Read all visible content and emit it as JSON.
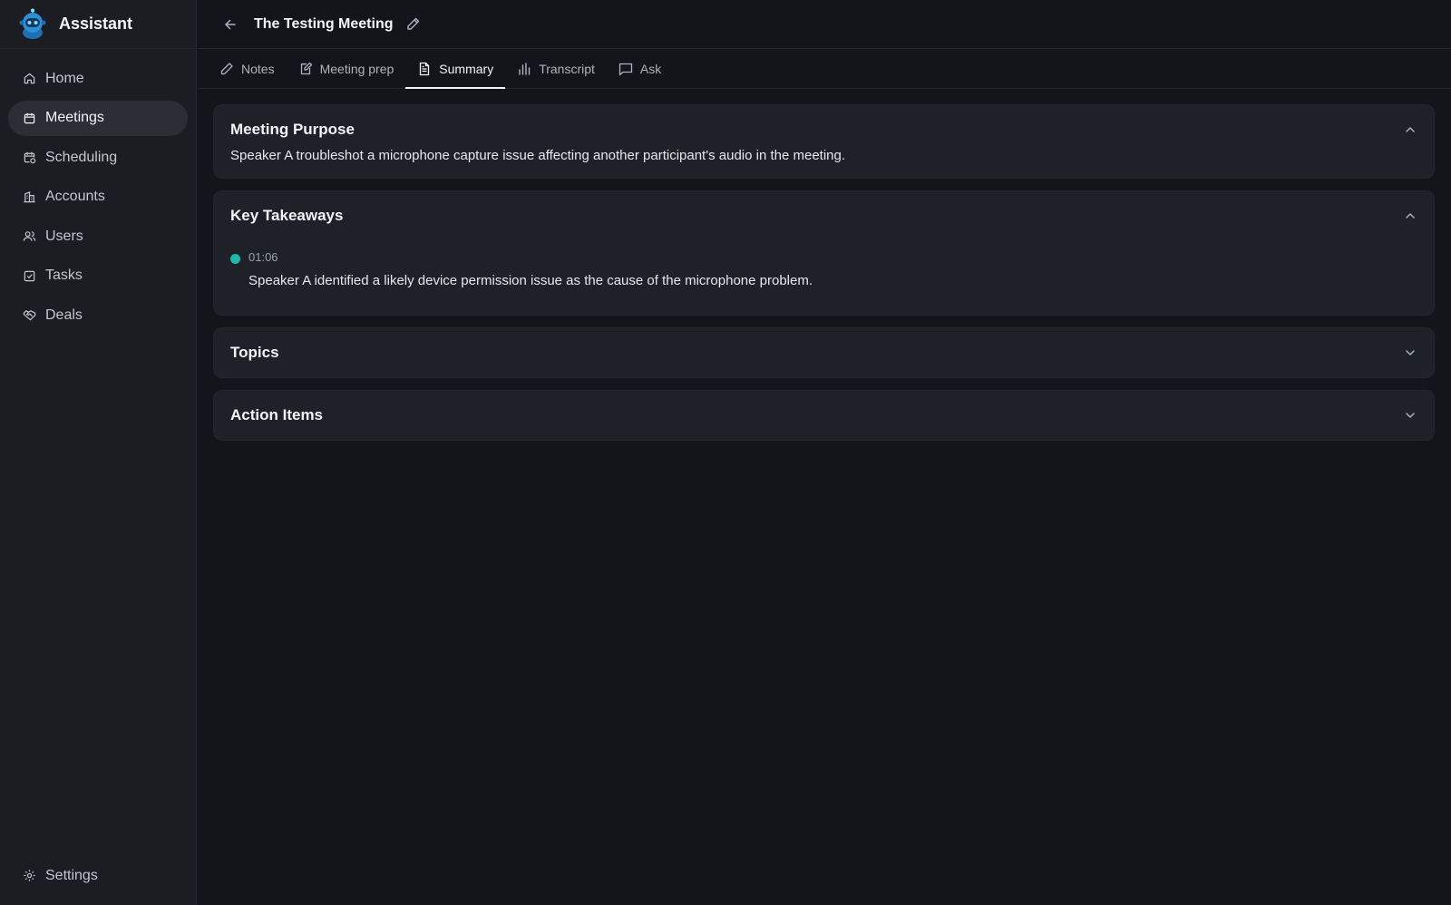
{
  "app": {
    "name": "Assistant"
  },
  "sidebar": {
    "items": [
      {
        "label": "Home",
        "icon": "home-icon"
      },
      {
        "label": "Meetings",
        "icon": "calendar-icon",
        "active": true
      },
      {
        "label": "Scheduling",
        "icon": "calendar-clock-icon"
      },
      {
        "label": "Accounts",
        "icon": "building-icon"
      },
      {
        "label": "Users",
        "icon": "users-icon"
      },
      {
        "label": "Tasks",
        "icon": "checkbox-icon"
      },
      {
        "label": "Deals",
        "icon": "handshake-icon"
      }
    ],
    "settings_label": "Settings"
  },
  "header": {
    "title": "The Testing Meeting"
  },
  "tabs": [
    {
      "label": "Notes",
      "icon": "pencil-icon"
    },
    {
      "label": "Meeting prep",
      "icon": "notepad-icon"
    },
    {
      "label": "Summary",
      "icon": "document-icon",
      "active": true
    },
    {
      "label": "Transcript",
      "icon": "bar-chart-icon"
    },
    {
      "label": "Ask",
      "icon": "chat-icon"
    }
  ],
  "sections": {
    "purpose": {
      "title": "Meeting Purpose",
      "text": "Speaker A troubleshot a microphone capture issue affecting another participant's audio in the meeting.",
      "expanded": true
    },
    "takeaways": {
      "title": "Key Takeaways",
      "expanded": true,
      "items": [
        {
          "time": "01:06",
          "text": "Speaker A identified a likely device permission issue as the cause of the microphone problem."
        }
      ]
    },
    "topics": {
      "title": "Topics",
      "expanded": false
    },
    "action_items": {
      "title": "Action Items",
      "expanded": false
    }
  },
  "colors": {
    "background": "#13151a",
    "sidebar": "#1b1d22",
    "card": "#1e2127",
    "accent_dot": "#1fb8ac",
    "brand_blue": "#2e8fd6"
  }
}
